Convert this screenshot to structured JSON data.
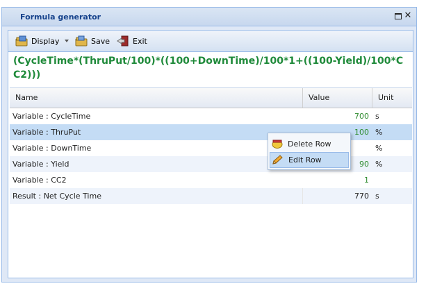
{
  "window": {
    "title": "Formula generator"
  },
  "toolbar": {
    "display_label": "Display",
    "save_label": "Save",
    "exit_label": "Exit"
  },
  "formula": "(CycleTime*(ThruPut/100)*((100+DownTime)/100*1+((100-Yield)/100*CC2)))",
  "grid": {
    "columns": [
      "Name",
      "Value",
      "Unit"
    ],
    "rows": [
      {
        "name": "Variable : CycleTime",
        "value": "700",
        "unit": "s"
      },
      {
        "name": "Variable : ThruPut",
        "value": "100",
        "unit": "%"
      },
      {
        "name": "Variable : DownTime",
        "value": "",
        "unit": "%"
      },
      {
        "name": "Variable : Yield",
        "value": "90",
        "unit": "%"
      },
      {
        "name": "Variable : CC2",
        "value": "1",
        "unit": ""
      },
      {
        "name": "Result : Net Cycle Time",
        "value": "770",
        "unit": "s"
      }
    ]
  },
  "context_menu": {
    "items": [
      "Delete Row",
      "Edit Row"
    ]
  },
  "colors": {
    "formula_text": "#1f8a3a",
    "value_green": "#2d8b2d",
    "selection": "#c4dcf5",
    "title_text": "#15428b"
  }
}
